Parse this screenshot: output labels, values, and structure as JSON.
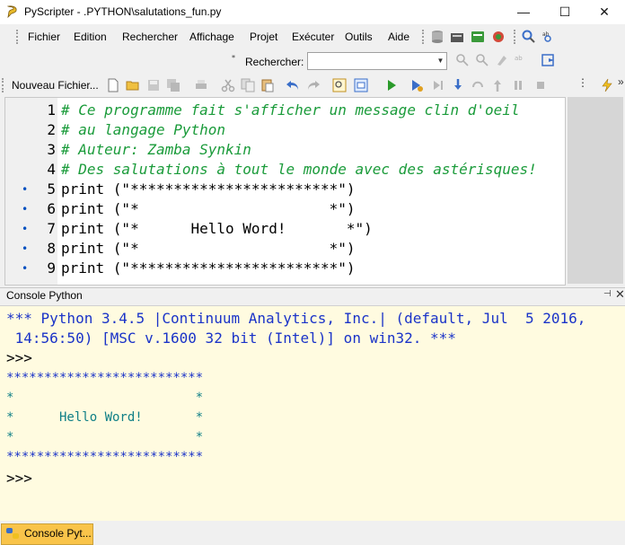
{
  "window": {
    "title": "PyScripter - .PYTHON\\salutations_fun.py",
    "minimize_glyph": "—",
    "maximize_glyph": "☐",
    "close_glyph": "✕"
  },
  "menu": {
    "items": [
      "Fichier",
      "Edition",
      "Rechercher",
      "Affichage",
      "Projet",
      "Exécuter",
      "Outils",
      "Aide"
    ]
  },
  "search": {
    "label": "Rechercher:",
    "value": ""
  },
  "toolbar": {
    "new_file_label": "Nouveau Fichier..."
  },
  "editor": {
    "lines": [
      {
        "num": "1",
        "text": "# Ce programme fait s'afficher un message clin d'oeil",
        "comment": true,
        "breakpoint": false
      },
      {
        "num": "2",
        "text": "# au langage Python",
        "comment": true,
        "breakpoint": false
      },
      {
        "num": "3",
        "text": "# Auteur: Zamba Synkin",
        "comment": true,
        "breakpoint": false
      },
      {
        "num": "4",
        "text": "# Des salutations à tout le monde avec des astérisques!",
        "comment": true,
        "breakpoint": false
      },
      {
        "num": "5",
        "text": "print (\"************************\")",
        "comment": false,
        "breakpoint": true
      },
      {
        "num": "6",
        "text": "print (\"*                      *\")",
        "comment": false,
        "breakpoint": true
      },
      {
        "num": "7",
        "text": "print (\"*      Hello Word!       *\")",
        "comment": false,
        "breakpoint": true
      },
      {
        "num": "8",
        "text": "print (\"*                      *\")",
        "comment": false,
        "breakpoint": true
      },
      {
        "num": "9",
        "text": "print (\"************************\")",
        "comment": false,
        "breakpoint": true
      }
    ]
  },
  "console": {
    "header_title": "Console Python",
    "pin_glyph": "⊣",
    "close_glyph": "✕",
    "banner_line1": "*** Python 3.4.5 |Continuum Analytics, Inc.| (default, Jul  5 2016,",
    "banner_line2": " 14:56:50) [MSC v.1600 32 bit (Intel)] on win32. ***",
    "prompt": ">>>",
    "output": [
      "**************************",
      "*                        *",
      "*      Hello Word!       *",
      "*                        *",
      "**************************"
    ],
    "final_prompt": ">>>"
  },
  "bottom_tab": {
    "label": "Console Pyt..."
  },
  "colors": {
    "comment": "#1a9b3a",
    "banner": "#1a33c8",
    "output": "#0f7f86",
    "console_bg": "#fffbe0",
    "tab_active": "#f9c44a"
  }
}
